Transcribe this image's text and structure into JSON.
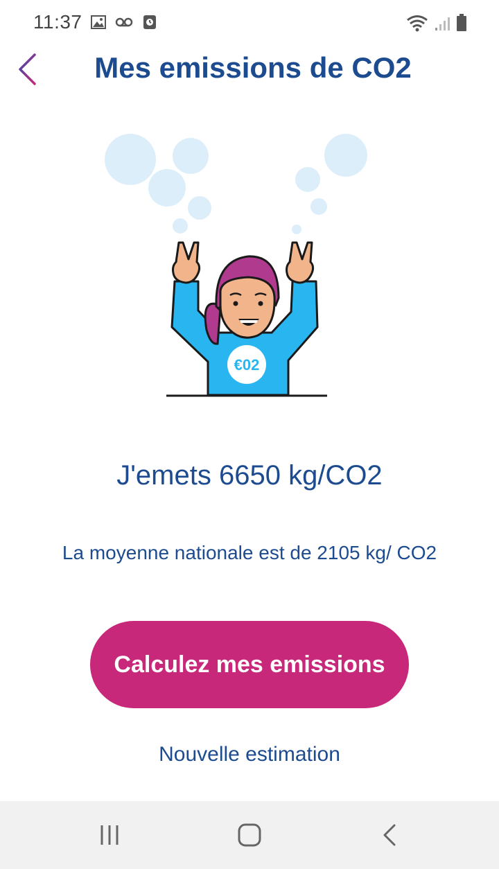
{
  "status_bar": {
    "time": "11:37",
    "left_icons": [
      "image-icon",
      "voicemail-icon",
      "clock-icon"
    ],
    "right_icons": [
      "wifi-icon",
      "signal-icon",
      "battery-icon"
    ]
  },
  "header": {
    "title": "Mes emissions de CO2",
    "back_icon": "arrow-left-icon"
  },
  "illustration": {
    "shirt_label": "€02"
  },
  "result": {
    "text": "J'emets 6650 kg/CO2"
  },
  "average": {
    "text": "La moyenne nationale est de 2105 kg/ CO2"
  },
  "actions": {
    "primary_label": "Calculez mes emissions",
    "secondary_label": "Nouvelle estimation"
  },
  "nav_bar": {
    "buttons": [
      "recent-apps-icon",
      "home-icon",
      "back-icon"
    ]
  },
  "colors": {
    "primary_text": "#1d4b8f",
    "accent": "#c8287a",
    "bubble": "#dceefa",
    "shirt": "#29b6f0",
    "hair": "#b03a8e"
  }
}
